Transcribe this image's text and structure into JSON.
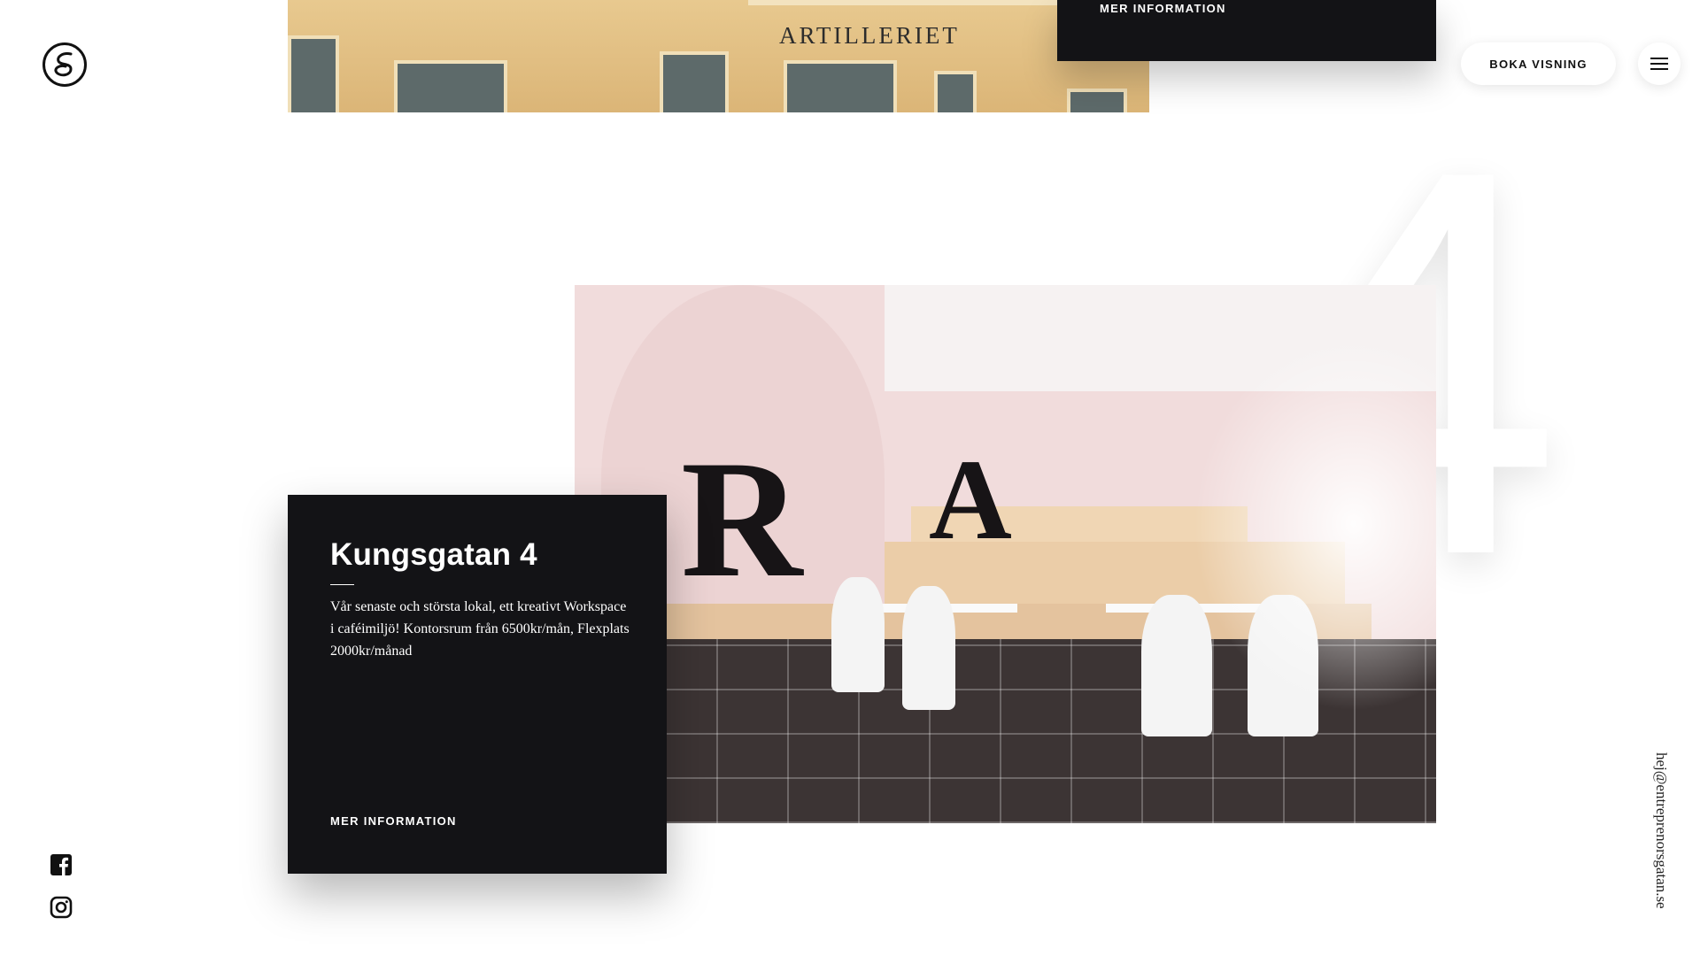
{
  "header": {
    "logo_icon": "entreprenorsgatan-logo-icon",
    "book_label": "BOKA VISNING",
    "menu_icon": "hamburger-menu-icon"
  },
  "previous_location": {
    "more_label": "MER INFORMATION",
    "photo_sign": "ARTILLERIET"
  },
  "location": {
    "number": "4",
    "title": "Kungsgatan 4",
    "description": "Vår senaste och största lokal, ett kreativt Workspace i caféimiljö! Kontorsrum från 6500kr/mån, Flexplats 2000kr/månad",
    "more_label": "MER INFORMATION",
    "photo_letters": [
      "R",
      "A"
    ]
  },
  "social": {
    "facebook_icon": "facebook-icon",
    "instagram_icon": "instagram-icon"
  },
  "contact": {
    "email": "hej@entreprenorsgatan.se"
  },
  "colors": {
    "card_bg": "#131316",
    "page_bg": "#ffffff",
    "photo_wall": "#f1dcdc"
  }
}
